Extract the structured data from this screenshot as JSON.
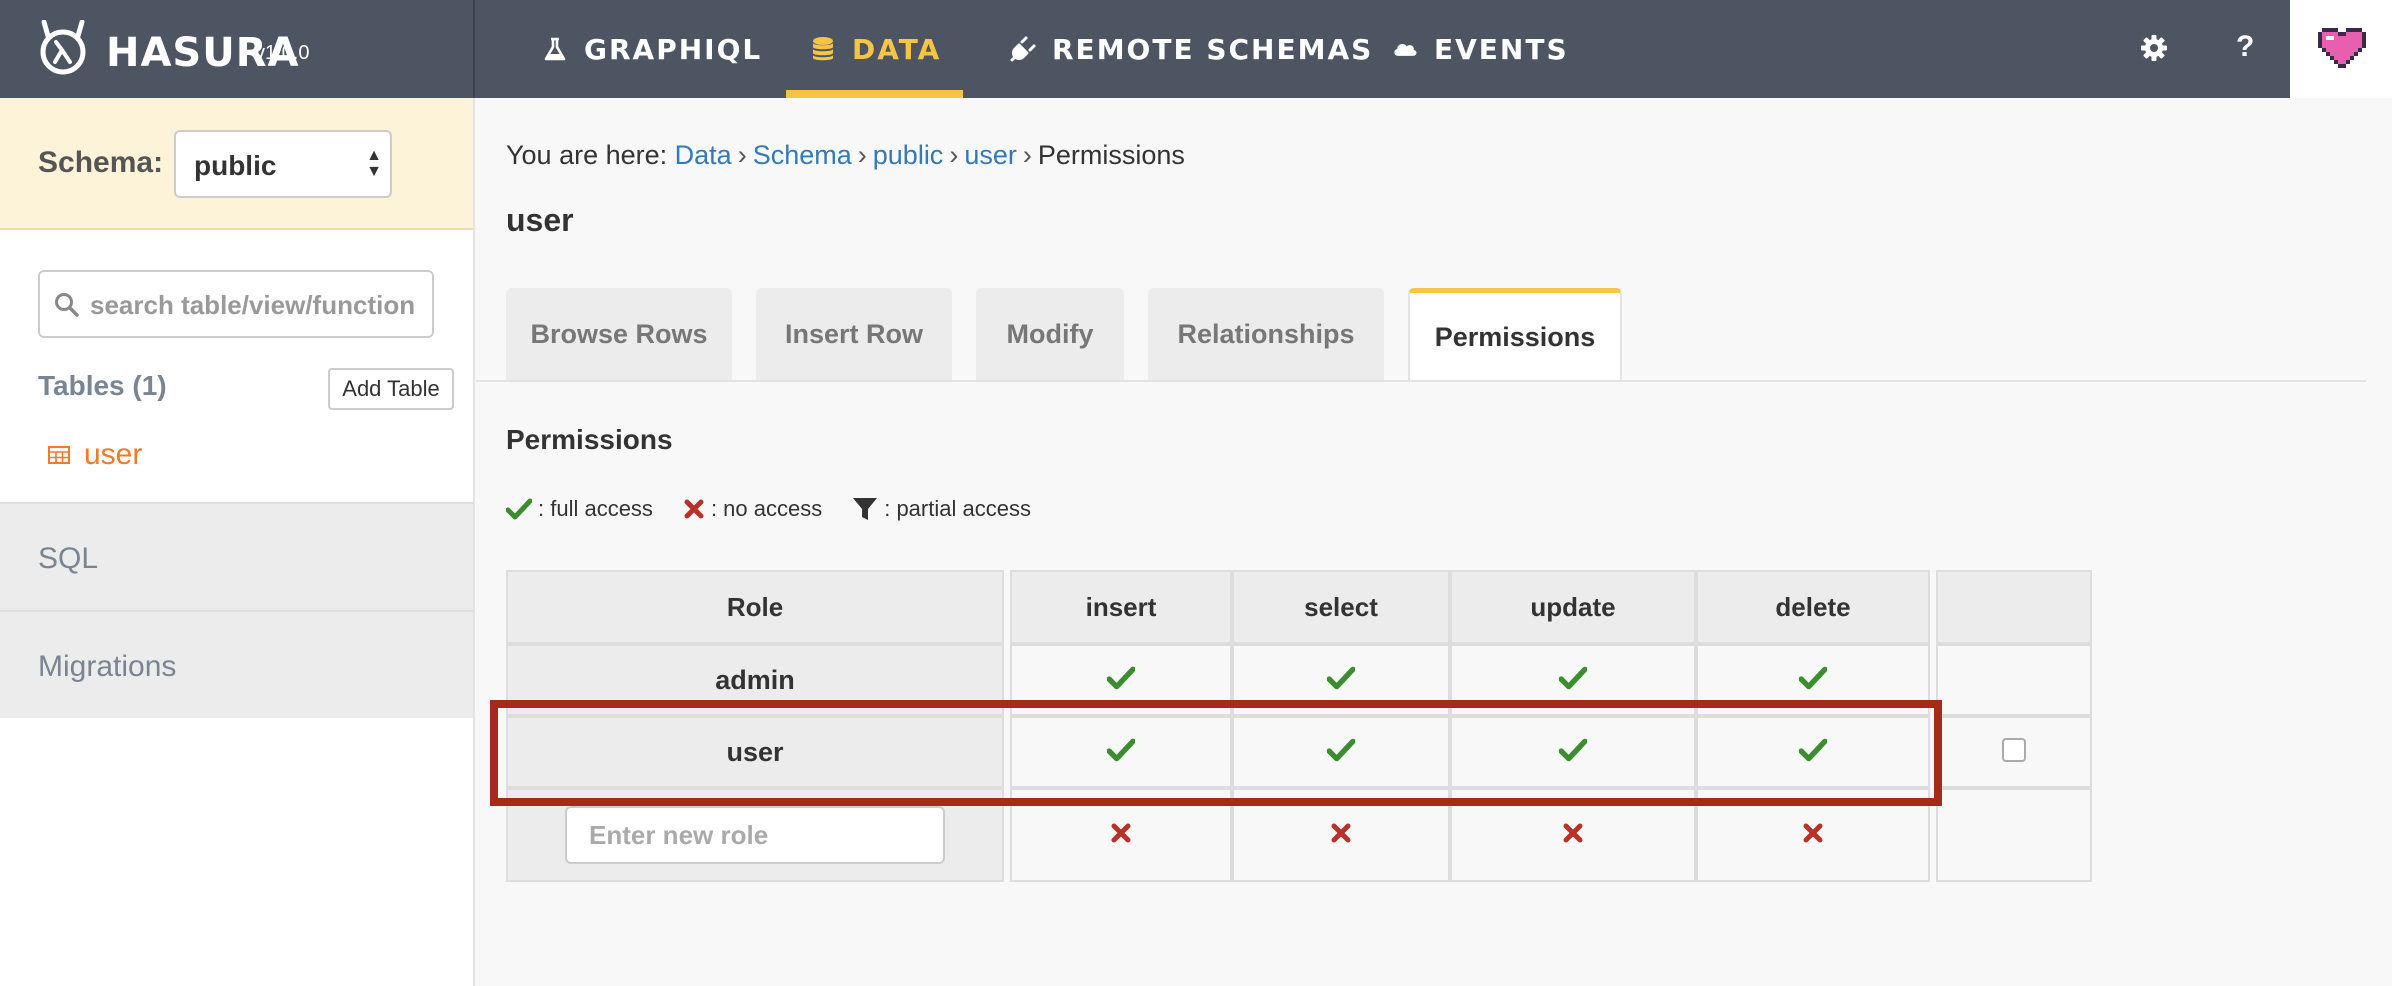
{
  "topbar": {
    "brand": "HASURA",
    "version": "v1.0.0",
    "nav": [
      {
        "label": "GRAPHIQL",
        "icon": "flask-icon"
      },
      {
        "label": "DATA",
        "icon": "database-icon",
        "active": true
      },
      {
        "label": "REMOTE SCHEMAS",
        "icon": "plug-icon"
      },
      {
        "label": "EVENTS",
        "icon": "cloud-icon"
      }
    ],
    "help_label": "?"
  },
  "sidebar": {
    "schema_label": "Schema:",
    "schema_value": "public",
    "search_placeholder": "search table/view/function",
    "tables_label": "Tables (1)",
    "add_table_label": "Add Table",
    "tables": [
      "user"
    ],
    "sections": [
      "SQL",
      "Migrations"
    ]
  },
  "breadcrumb": {
    "prefix": "You are here:",
    "items": [
      "Data",
      "Schema",
      "public",
      "user"
    ],
    "current": "Permissions"
  },
  "page_title": "user",
  "tabs": [
    "Browse Rows",
    "Insert Row",
    "Modify",
    "Relationships",
    "Permissions"
  ],
  "active_tab": "Permissions",
  "permissions": {
    "title": "Permissions",
    "legend": {
      "full": ": full access",
      "none": ": no access",
      "partial": ": partial access"
    },
    "columns": [
      "Role",
      "insert",
      "select",
      "update",
      "delete"
    ],
    "rows": [
      {
        "role": "admin",
        "access": [
          "full",
          "full",
          "full",
          "full"
        ]
      },
      {
        "role": "user",
        "access": [
          "full",
          "full",
          "full",
          "full"
        ]
      }
    ],
    "new_role_placeholder": "Enter new role",
    "new_role_access": [
      "none",
      "none",
      "none",
      "none"
    ]
  },
  "colors": {
    "topbar": "#4d5563",
    "accent": "#f6c543",
    "link": "#337ab7",
    "table_link": "#f27a2a",
    "full_access": "#3c8d2f",
    "no_access": "#b8322a",
    "highlight": "#a52a1c"
  }
}
